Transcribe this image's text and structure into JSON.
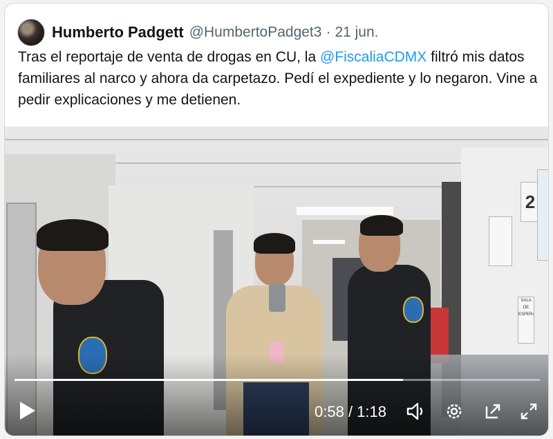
{
  "tweet": {
    "author_name": "Humberto Padgett",
    "author_handle": "@HumbertoPadget3",
    "separator": "·",
    "date": "21 jun.",
    "text_before_mention": "Tras el reportaje de venta de drogas en CU, la ",
    "mention": "@FiscaliaCDMX",
    "text_after_mention": " filtró mis datos familiares al narco y ahora da carpetazo. Pedí el expediente y lo negaron. Vine a pedir explicaciones y me detienen."
  },
  "video": {
    "current_time": "0:58",
    "duration": "1:18",
    "time_separator": " / ",
    "progress_fraction": 0.74,
    "icons": [
      "play-icon",
      "volume-icon",
      "settings-gear-icon",
      "pop-out-icon",
      "fullscreen-icon"
    ]
  },
  "scene_signs": {
    "floor_number": "2",
    "sala_label": "SALA DE ESPERA"
  },
  "colors": {
    "mention": "#1d9bf0",
    "secondary_text": "#536471",
    "primary_text": "#0f1419"
  }
}
